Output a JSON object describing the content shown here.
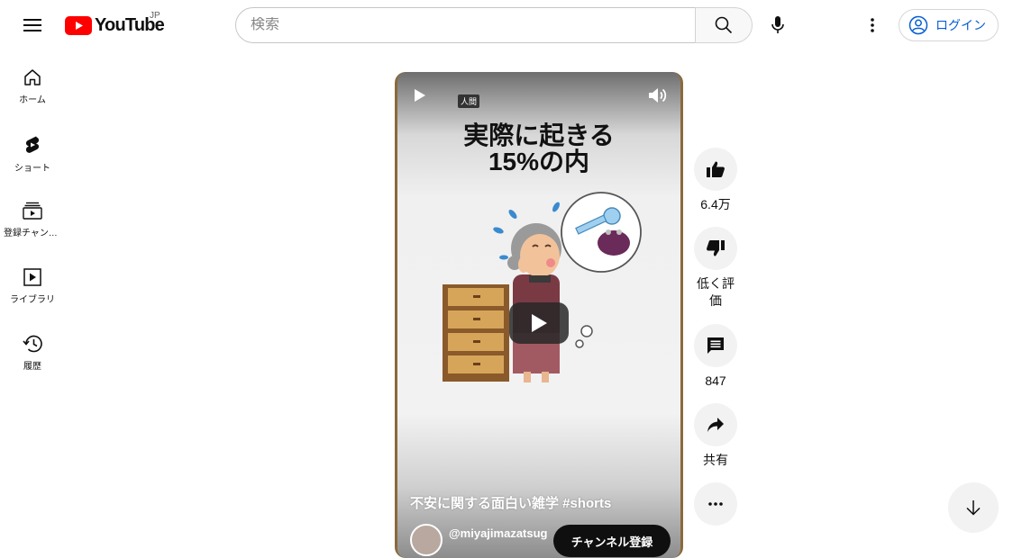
{
  "header": {
    "logo_text": "YouTube",
    "region": "JP",
    "search_placeholder": "検索",
    "login_label": "ログイン"
  },
  "sidebar": {
    "items": [
      {
        "label": "ホーム",
        "icon": "home-icon"
      },
      {
        "label": "ショート",
        "icon": "shorts-icon"
      },
      {
        "label": "登録チャンネル",
        "icon": "subscriptions-icon"
      },
      {
        "label": "ライブラリ",
        "icon": "library-icon"
      },
      {
        "label": "履歴",
        "icon": "history-icon"
      }
    ]
  },
  "player": {
    "badge": "人間",
    "overlay_title_line1": "実際に起きる",
    "overlay_title_line2": "15%の内",
    "caption": "不安に関する面白い雑学 #shorts",
    "channel_handle": "@miyajimazatsug",
    "subscribe_label": "チャンネル登録"
  },
  "actions": {
    "like_count": "6.4万",
    "dislike_label": "低く評価",
    "comment_count": "847",
    "share_label": "共有"
  },
  "colors": {
    "brand_red": "#ff0000",
    "link_blue": "#065fd4"
  }
}
